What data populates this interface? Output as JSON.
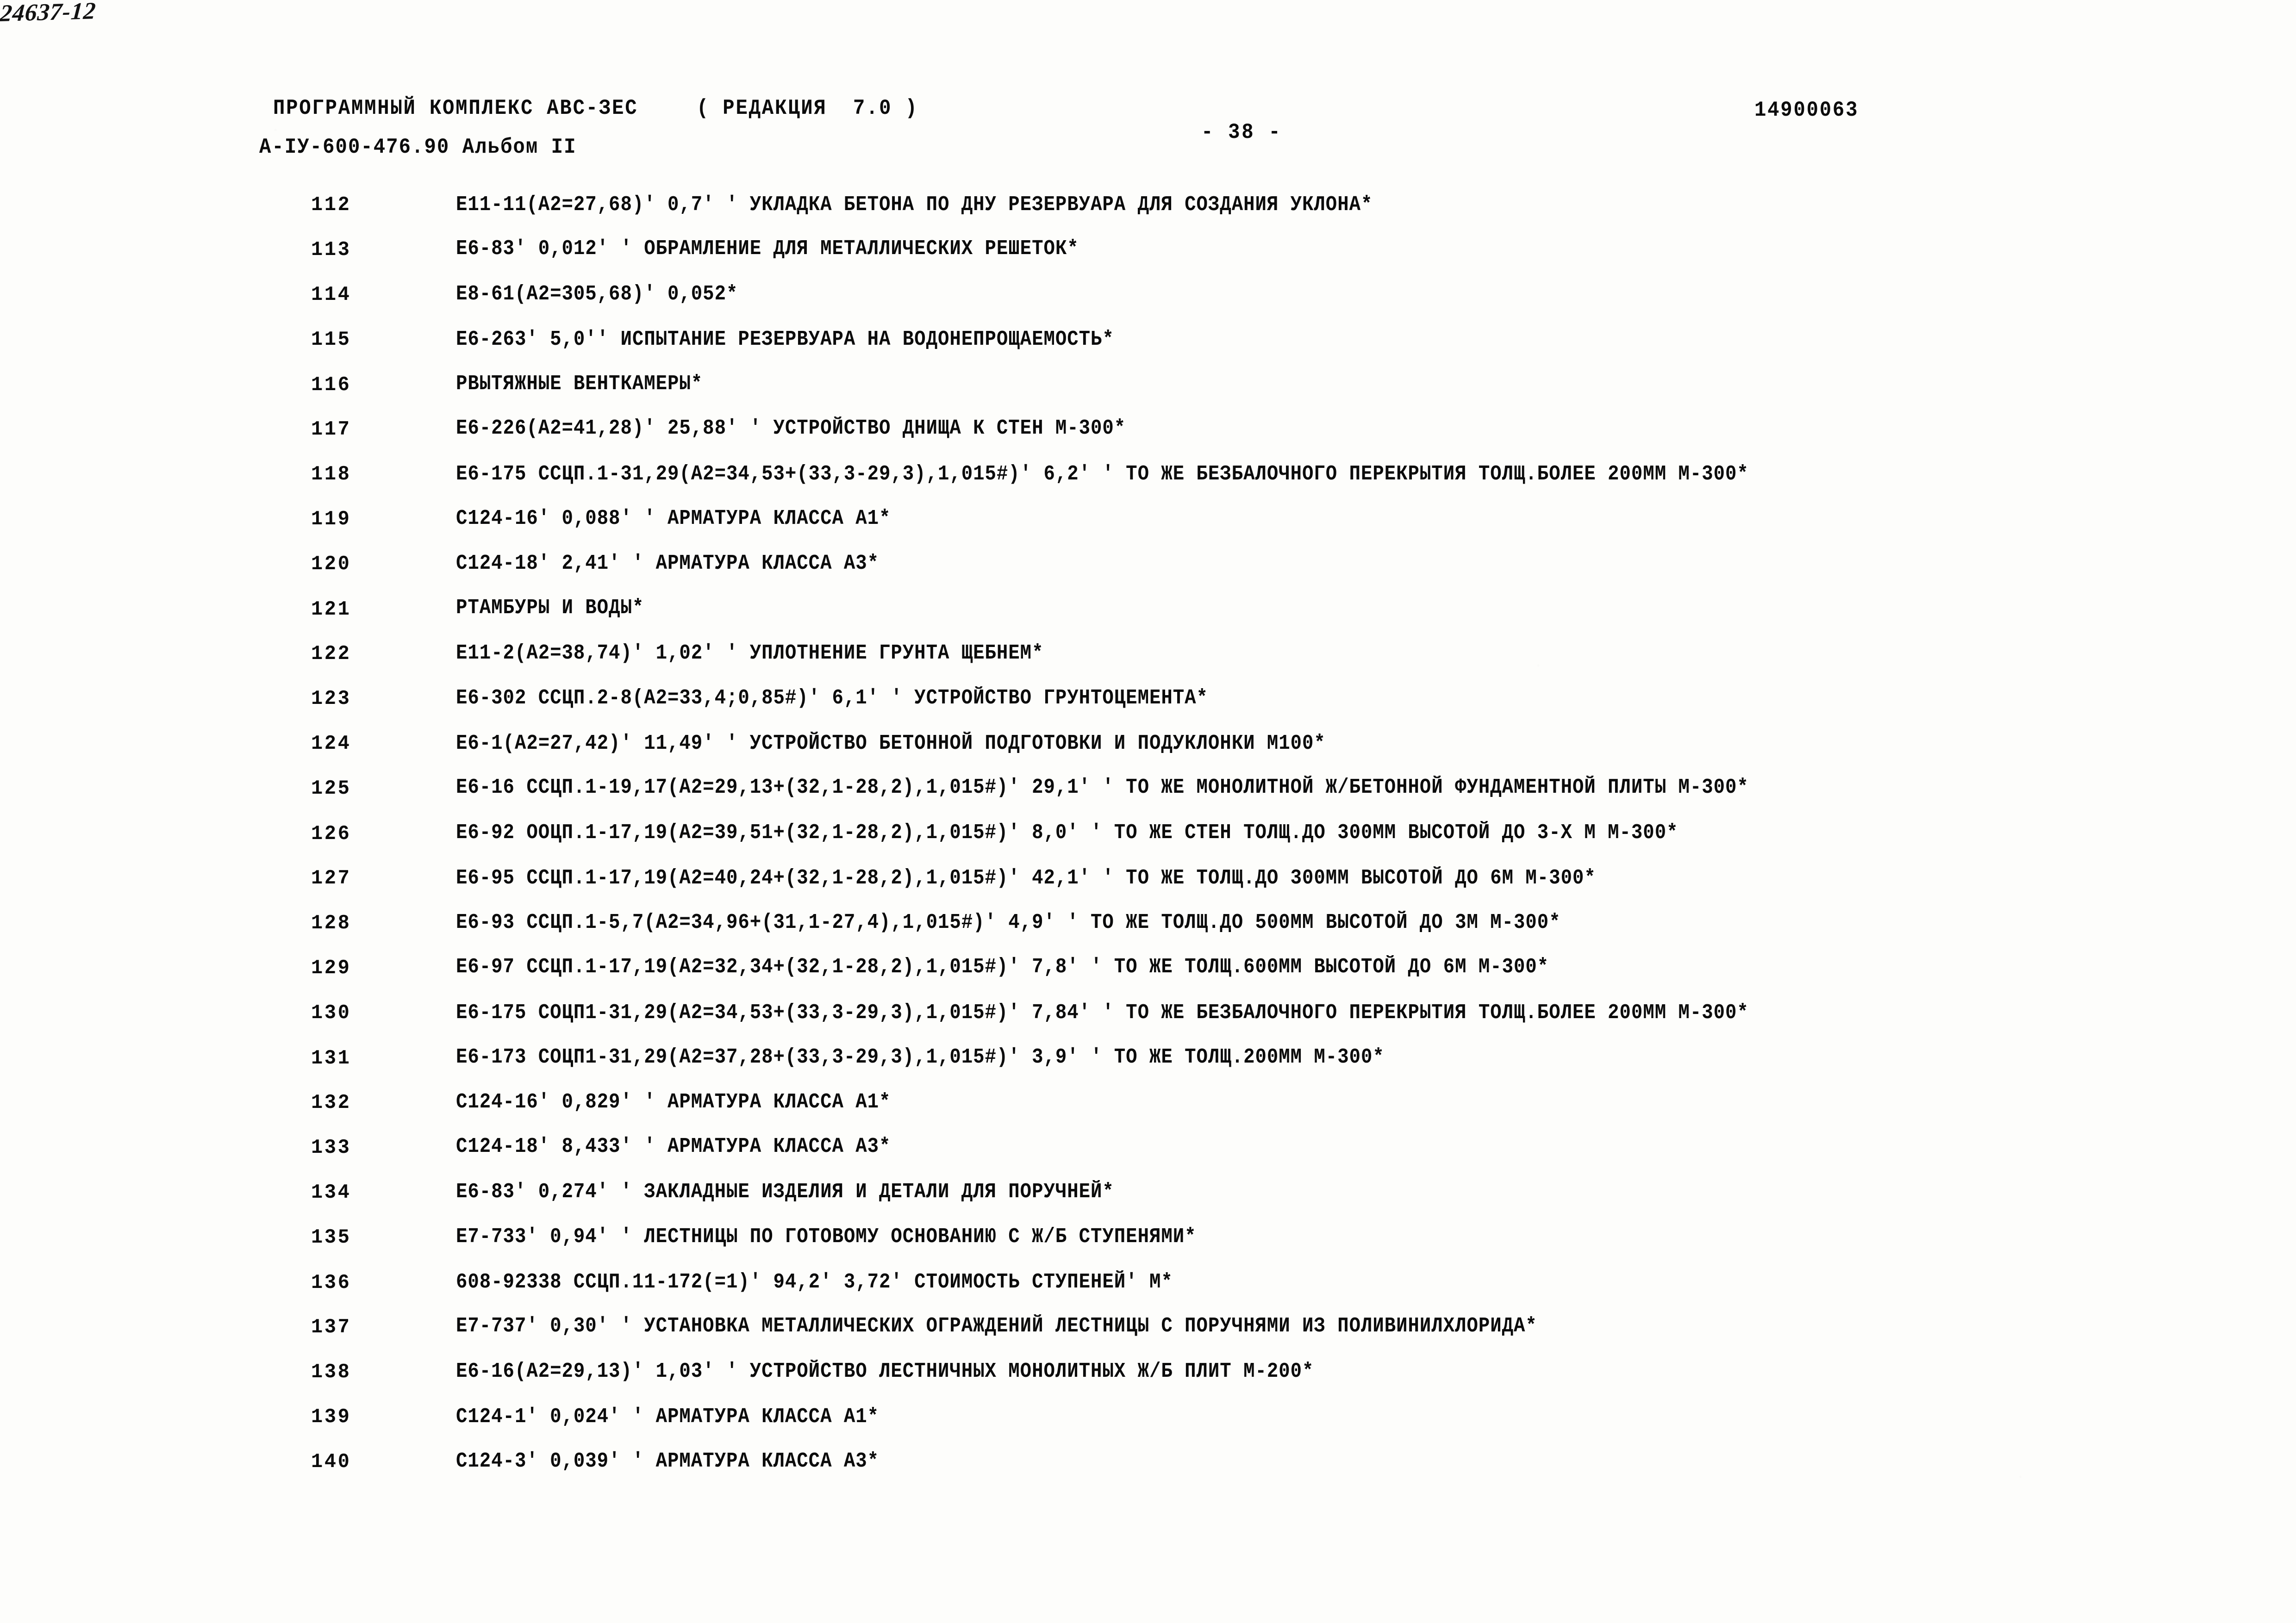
{
  "header": {
    "program": "ПРОГРАММНЫЙ КОМПЛЕКС АВС-ЗЕС",
    "revision": "( РЕДАКЦИЯ  7.0 )",
    "album": "А-IУ-600-476.90 Альбом II",
    "page_number": "- 38 -",
    "doc_number_handwritten": "24637-12",
    "code": "14900063"
  },
  "listing": {
    "rows": [
      {
        "num": "112",
        "text": "Е11-11(А2=27,68)' 0,7' ' УКЛАДКА БЕТОНА ПО ДНУ РЕЗЕРВУАРА ДЛЯ СОЗДАНИЯ УКЛОНА*"
      },
      {
        "num": "113",
        "text": "Е6-83' 0,012' ' ОБРАМЛЕНИЕ ДЛЯ МЕТАЛЛИЧЕСКИХ РЕШЕТОК*"
      },
      {
        "num": "114",
        "text": "Е8-61(А2=305,68)' 0,052*"
      },
      {
        "num": "115",
        "text": "Е6-263' 5,0'' ИСПЫТАНИЕ РЕЗЕРВУАРА НА ВОДОНЕПРОЩАЕМОСТЬ*"
      },
      {
        "num": "116",
        "text": "РВЫТЯЖНЫЕ ВЕНТКАМЕРЫ*"
      },
      {
        "num": "117",
        "text": "Е6-226(А2=41,28)' 25,88' ' УСТРОЙСТВО ДНИЩА К СТЕН М-300*"
      },
      {
        "num": "118",
        "text": "Е6-175 ССЦП.1-31,29(А2=34,53+(33,3-29,3),1,015#)' 6,2' ' ТО ЖЕ БЕЗБАЛОЧНОГО ПЕРЕКРЫТИЯ ТОЛЩ.БОЛЕЕ 200ММ М-300*"
      },
      {
        "num": "119",
        "text": "С124-16' 0,088' ' АРМАТУРА КЛАССА А1*"
      },
      {
        "num": "120",
        "text": "С124-18' 2,41' ' АРМАТУРА КЛАССА А3*"
      },
      {
        "num": "121",
        "text": "РТАМБУРЫ И ВОДЫ*"
      },
      {
        "num": "122",
        "text": "Е11-2(А2=38,74)' 1,02' ' УПЛОТНЕНИЕ ГРУНТА ЩЕБНЕМ*"
      },
      {
        "num": "123",
        "text": "Е6-302 ССЦП.2-8(А2=33,4;0,85#)' 6,1' ' УСТРОЙСТВО ГРУНТОЦЕМЕНТА*"
      },
      {
        "num": "124",
        "text": "Е6-1(А2=27,42)' 11,49' ' УСТРОЙСТВО БЕТОННОЙ ПОДГОТОВКИ И ПОДУКЛОНКИ М100*"
      },
      {
        "num": "125",
        "text": "Е6-16 ССЦП.1-19,17(А2=29,13+(32,1-28,2),1,015#)' 29,1' ' ТО ЖЕ МОНОЛИТНОЙ Ж/БЕТОННОЙ ФУНДАМЕНТНОЙ ПЛИТЫ М-300*"
      },
      {
        "num": "126",
        "text": "Е6-92 ООЦП.1-17,19(А2=39,51+(32,1-28,2),1,015#)' 8,0' ' ТО ЖЕ СТЕН ТОЛЩ.ДО 300ММ ВЫСОТОЙ ДО 3-Х М М-300*"
      },
      {
        "num": "127",
        "text": "Е6-95 ССЦП.1-17,19(А2=40,24+(32,1-28,2),1,015#)' 42,1' ' ТО ЖЕ ТОЛЩ.ДО 300ММ ВЫСОТОЙ ДО 6М М-300*"
      },
      {
        "num": "128",
        "text": "Е6-93 ССЦП.1-5,7(А2=34,96+(31,1-27,4),1,015#)' 4,9' ' ТО ЖЕ ТОЛЩ.ДО 500ММ ВЫСОТОЙ ДО 3М М-300*"
      },
      {
        "num": "129",
        "text": "Е6-97 ССЦП.1-17,19(А2=32,34+(32,1-28,2),1,015#)' 7,8' ' ТО ЖЕ ТОЛЩ.600ММ ВЫСОТОЙ ДО 6М М-300*"
      },
      {
        "num": "130",
        "text": "Е6-175 СОЦП1-31,29(А2=34,53+(33,3-29,3),1,015#)' 7,84' ' ТО ЖЕ БЕЗБАЛОЧНОГО ПЕРЕКРЫТИЯ ТОЛЩ.БОЛЕЕ 200ММ М-300*"
      },
      {
        "num": "131",
        "text": "Е6-173 СОЦП1-31,29(А2=37,28+(33,3-29,3),1,015#)' 3,9' ' ТО ЖЕ ТОЛЩ.200ММ М-300*"
      },
      {
        "num": "132",
        "text": "С124-16' 0,829' ' АРМАТУРА КЛАССА А1*"
      },
      {
        "num": "133",
        "text": "С124-18' 8,433' ' АРМАТУРА КЛАССА А3*"
      },
      {
        "num": "134",
        "text": "Е6-83' 0,274' ' ЗАКЛАДНЫЕ ИЗДЕЛИЯ И ДЕТАЛИ ДЛЯ ПОРУЧНЕЙ*"
      },
      {
        "num": "135",
        "text": "Е7-733' 0,94' ' ЛЕСТНИЦЫ ПО ГОТОВОМУ ОСНОВАНИЮ С Ж/Б СТУПЕНЯМИ*"
      },
      {
        "num": "136",
        "text": "608-92338 ССЦП.11-172(=1)' 94,2' 3,72' СТОИМОСТЬ СТУПЕНЕЙ' М*"
      },
      {
        "num": "137",
        "text": "Е7-737' 0,30' ' УСТАНОВКА МЕТАЛЛИЧЕСКИХ ОГРАЖДЕНИЙ ЛЕСТНИЦЫ С ПОРУЧНЯМИ ИЗ ПОЛИВИНИЛХЛОРИДА*"
      },
      {
        "num": "138",
        "text": "Е6-16(А2=29,13)' 1,03' ' УСТРОЙСТВО ЛЕСТНИЧНЫХ МОНОЛИТНЫХ Ж/Б ПЛИТ М-200*"
      },
      {
        "num": "139",
        "text": "С124-1' 0,024' ' АРМАТУРА КЛАССА А1*"
      },
      {
        "num": "140",
        "text": "С124-3' 0,039' ' АРМАТУРА КЛАССА А3*"
      }
    ]
  }
}
